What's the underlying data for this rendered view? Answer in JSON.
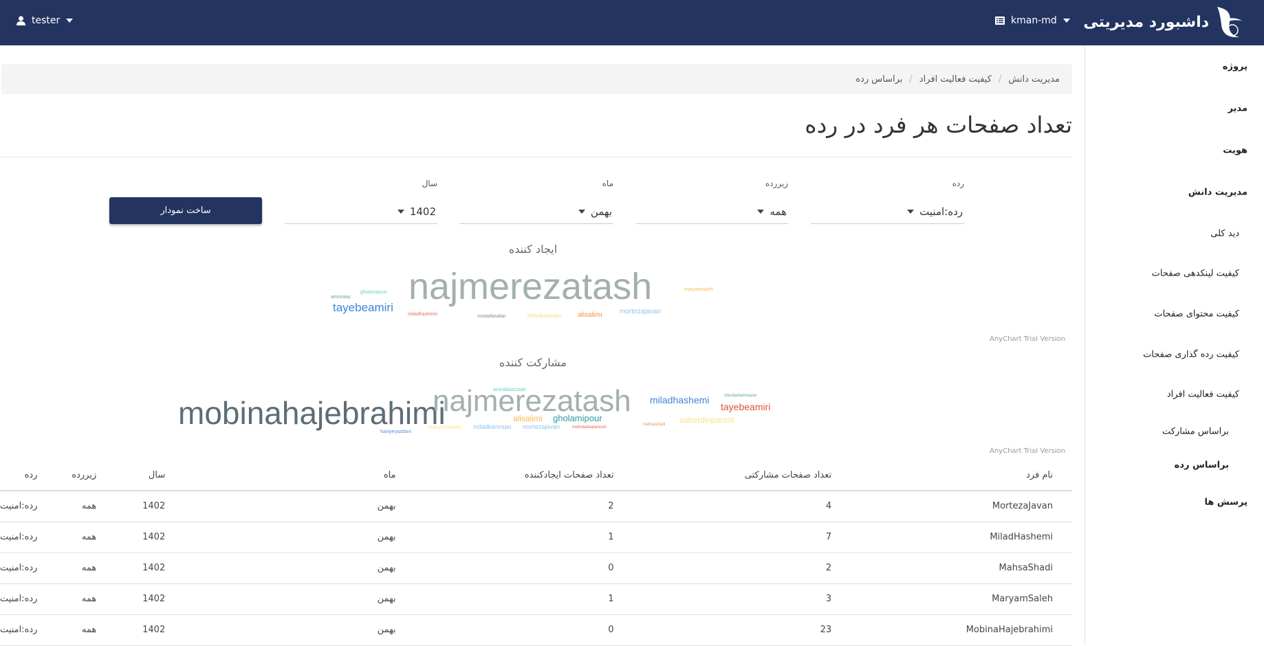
{
  "header": {
    "user": "tester",
    "project": "kman-md",
    "brand": "داشبورد مدیریتی"
  },
  "sidebar": [
    "پروژه",
    "مدیر",
    "هویت",
    "مدیریت دانش",
    "دید کلی",
    "کیفیت لینکدهی صفحات",
    "کیفیت محتوای صفحات",
    "کیفیت رده گذاری صفحات",
    "کیفیت فعالیت افراد",
    "براساس مشارکت",
    "براساس رده",
    "پرسش ها"
  ],
  "breadcrumb": [
    "مدیریت دانش",
    "کیفیت فعالیت افراد",
    "براساس رده"
  ],
  "page_title": "تعداد صفحات هر فرد در رده",
  "filters": {
    "category_label": "رده",
    "category_value": "رده:امنیت",
    "subcategory_label": "زیررده",
    "subcategory_value": "همه",
    "month_label": "ماه",
    "month_value": "بهمن",
    "year_label": "سال",
    "year_value": "1402",
    "build_button": "ساخت نمودار"
  },
  "cloud1": {
    "title": "ایجاد کننده",
    "trial": "AnyChart Trial Version",
    "words": [
      {
        "text": "aminraay",
        "color": "#5aa5a6"
      },
      {
        "text": "gholamipour",
        "color": "#5fd3c0"
      },
      {
        "text": "tayebeamiri",
        "color": "#3d85d8"
      },
      {
        "text": "najmerezatash",
        "color": "#a3b0ae"
      },
      {
        "text": "miladhashemi",
        "color": "#e0705f"
      },
      {
        "text": "mostafasalari",
        "color": "#888888"
      },
      {
        "text": "miladkarimian",
        "color": "#ffd98a"
      },
      {
        "text": "alisalimi",
        "color": "#f0914a"
      },
      {
        "text": "mortezajavan",
        "color": "#8fc3ef"
      },
      {
        "text": "maryamsaleh",
        "color": "#f8b94a"
      }
    ]
  },
  "cloud2": {
    "title": "مشارکت کننده",
    "trial": "AnyChart Trial Version",
    "words": [
      {
        "text": "mobinahajebrahimi",
        "color": "#5d6d78"
      },
      {
        "text": "haniyeyazdani",
        "color": "#5b8fd8"
      },
      {
        "text": "najmerezatash",
        "color": "#a3b0ae"
      },
      {
        "text": "amirabbaszade",
        "color": "#5fd3c0"
      },
      {
        "text": "alisalimi",
        "color": "#f8b94a"
      },
      {
        "text": "gholamipour",
        "color": "#2e9aa0"
      },
      {
        "text": "maryamsaleh",
        "color": "#ffe08a"
      },
      {
        "text": "miladkarimian",
        "color": "#8fc3ef"
      },
      {
        "text": "mortezajavan",
        "color": "#8fc3ef"
      },
      {
        "text": "mehrdadsalaroush",
        "color": "#e06050"
      },
      {
        "text": "miladhashemi",
        "color": "#3d85d8"
      },
      {
        "text": "niloufarkarimiazar",
        "color": "#5aa5a6"
      },
      {
        "text": "tayebeamiri",
        "color": "#e0503a"
      },
      {
        "text": "saberdinparast",
        "color": "#ffe08a"
      },
      {
        "text": "mahsashadi",
        "color": "#f0914a"
      }
    ]
  },
  "table": {
    "headers": [
      "نام فرد",
      "تعداد صفحات مشارکتی",
      "تعداد صفحات ایجادکننده",
      "ماه",
      "سال",
      "زیررده",
      "رده"
    ],
    "rows": [
      [
        "MortezaJavan",
        "4",
        "2",
        "بهمن",
        "1402",
        "همه",
        "رده:امنیت"
      ],
      [
        "MiladHashemi",
        "7",
        "1",
        "بهمن",
        "1402",
        "همه",
        "رده:امنیت"
      ],
      [
        "MahsaShadi",
        "2",
        "0",
        "بهمن",
        "1402",
        "همه",
        "رده:امنیت"
      ],
      [
        "MaryamSaleh",
        "3",
        "1",
        "بهمن",
        "1402",
        "همه",
        "رده:امنیت"
      ],
      [
        "MobinaHajebrahimi",
        "23",
        "0",
        "بهمن",
        "1402",
        "همه",
        "رده:امنیت"
      ]
    ]
  }
}
